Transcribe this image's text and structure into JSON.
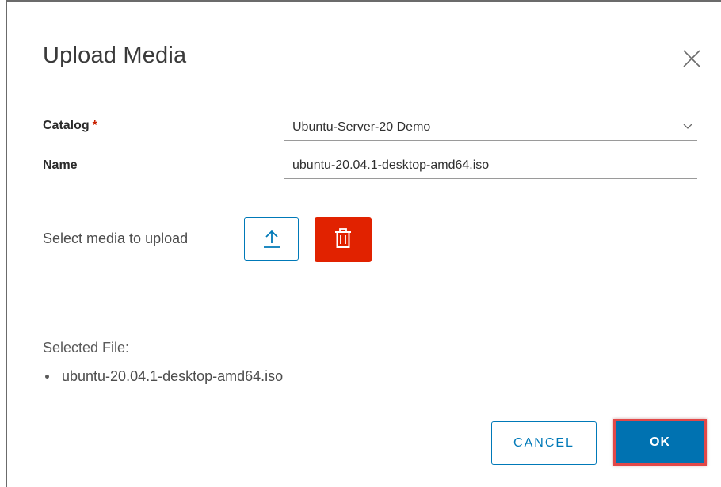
{
  "dialog": {
    "title": "Upload Media",
    "close_icon": "close-icon"
  },
  "form": {
    "catalog": {
      "label": "Catalog",
      "required_marker": "*",
      "selected_value": "Ubuntu-Server-20 Demo",
      "icon": "chevron-down-icon"
    },
    "name": {
      "label": "Name",
      "value": "ubuntu-20.04.1-desktop-amd64.iso"
    }
  },
  "upload": {
    "label": "Select media to upload",
    "upload_icon": "upload-arrow-icon",
    "delete_icon": "trash-icon"
  },
  "selected": {
    "heading": "Selected File:",
    "files": [
      "ubuntu-20.04.1-desktop-amd64.iso"
    ]
  },
  "footer": {
    "cancel_label": "CANCEL",
    "ok_label": "OK"
  },
  "colors": {
    "primary": "#0072b1",
    "danger": "#e12200",
    "highlight": "#e24848",
    "required": "#c92100"
  }
}
